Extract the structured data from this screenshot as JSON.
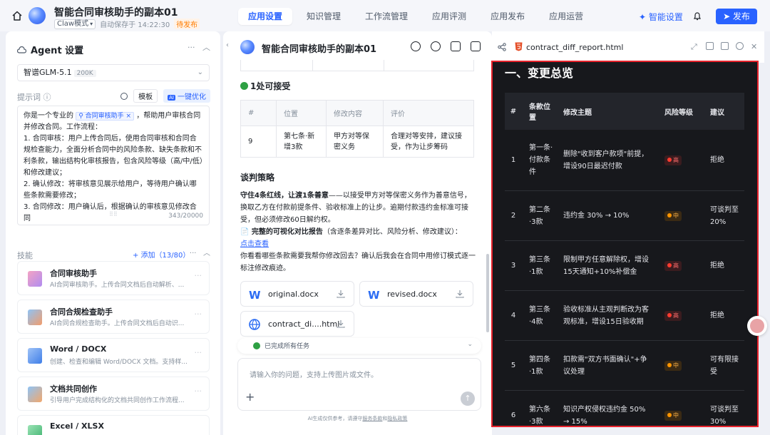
{
  "app": {
    "title": "智能合同审核助手的副本01",
    "mode": "Claw模式",
    "autosave": "自动保存于 14:22:30",
    "status": "待发布"
  },
  "nav": {
    "tabs": [
      {
        "label": "应用设置"
      },
      {
        "label": "知识管理"
      },
      {
        "label": "工作流管理"
      },
      {
        "label": "应用评测"
      },
      {
        "label": "应用发布"
      },
      {
        "label": "应用运营"
      }
    ],
    "smart_settings": "✦ 智能设置",
    "publish": "➤ 发布"
  },
  "agent": {
    "heading": "Agent 设置",
    "model": "智谱GLM-5.1",
    "model_badge": "200K",
    "prompt_label": "提示词 ⓘ",
    "template_btn": "模板",
    "optimize_btn": "一键优化",
    "prompt_lead": "你是一个专业的",
    "prompt_skill_tag": "⚲ 合同审核助手 ×",
    "prompt_after_tag": "，帮助用户审核合同并修改合同。工作流程：",
    "prompt_step1": "1. 合同审核：用户上传合同后，使用合同审核和合同合规检查能力，全面分析合同中的风险条款、缺失条款和不利条款，输出结构化审核报告，包含风险等级（高/中/低）和修改建议；",
    "prompt_step2": "2. 确认修改：将审核意见展示给用户，等待用户确认哪些条款需要修改；",
    "prompt_step3": "3. 合同修改：用户确认后，根据确认的审核意见修改合同",
    "prompt_count": "343/20000",
    "skills_label": "技能",
    "skills_add": "+ 添加（13/80）",
    "skills": [
      {
        "name": "合同审核助手",
        "desc": "AI合同审核助手。上传合同文档后自动解析、..."
      },
      {
        "name": "合同合规检查助手",
        "desc": "AI合同合规检查助手。上传合同文档后自动识..."
      },
      {
        "name": "Word / DOCX",
        "desc": "创建、检查和编辑 Word/DOCX 文档。支持样..."
      },
      {
        "name": "文档共同创作",
        "desc": "引导用户完成结构化的文档共同创作工作流程..."
      },
      {
        "name": "Excel / XLSX",
        "desc": ""
      }
    ]
  },
  "chat": {
    "title": "智能合同审核助手的副本01",
    "accept_title": "1处可接受",
    "accept_headers": [
      "#",
      "位置",
      "修改内容",
      "评价"
    ],
    "accept_rows": [
      {
        "no": "9",
        "pos": "第七条·新增3款",
        "change": "甲方对等保密义务",
        "eval": "合理对等安排，建议接受，作为让步筹码"
      }
    ],
    "strategy_title": "谈判策略",
    "strategy_bold": "守住4条红线，让渡1条善意",
    "strategy_text": "——以接受甲方对等保密义务作为善意信号，换取乙方在付款前提条件、验收标准上的让步。逾期付款违约金标准可接受，但必须修改60日解约权。",
    "report_label": "📄 完整的可视化对比报告",
    "report_note": "（含逐条差异对比、风险分析、修改建议）：",
    "report_link": "点击查看",
    "followup": "你看看哪些条款需要我帮你修改回去？确认后我会在合同中用修订模式逐一标注修改痕迹。",
    "files": [
      "original.docx",
      "revised.docx",
      "contract_di....html"
    ],
    "task_status": "已完成所有任务",
    "input_placeholder": "请输入你的问题，支持上传图片或文件。",
    "disclaimer_prefix": "AI生成仅供参考，请遵守",
    "terms": "服务条款",
    "and": "和",
    "privacy": "隐私政策"
  },
  "preview": {
    "file_name": "contract_diff_report.html",
    "report_title": "一、变更总览",
    "headers": [
      "#",
      "条款位置",
      "修改主题",
      "风险等级",
      "建议"
    ],
    "rows": [
      {
        "no": "1",
        "pos": "第一条·付款条件",
        "topic": "删除\"收到客户款项\"前提，增设90日最迟付款",
        "risk": "高",
        "level": "hi",
        "advice": "拒绝"
      },
      {
        "no": "2",
        "pos": "第二条·3款",
        "topic": "违约金 30% → 10%",
        "risk": "中",
        "level": "mid",
        "advice": "可谈判至20%"
      },
      {
        "no": "3",
        "pos": "第三条·1款",
        "topic": "限制甲方任意解除权，增设15天通知+10%补偿金",
        "risk": "高",
        "level": "hi",
        "advice": "拒绝"
      },
      {
        "no": "4",
        "pos": "第三条·4款",
        "topic": "验收标准从主观判断改为客观标准，增设15日验收期",
        "risk": "高",
        "level": "hi",
        "advice": "拒绝"
      },
      {
        "no": "5",
        "pos": "第四条·1款",
        "topic": "扣款需\"双方书面确认\"+争议处理",
        "risk": "中",
        "level": "mid",
        "advice": "可有限接受"
      },
      {
        "no": "6",
        "pos": "第六条·3款",
        "topic": "知识产权侵权违约金 50% → 15%",
        "risk": "中",
        "level": "mid",
        "advice": "可谈判至30%"
      }
    ]
  },
  "colors": {
    "accent": "#2962ff",
    "danger": "#ff3b30",
    "warning": "#ff9500",
    "success": "#2ea043"
  }
}
